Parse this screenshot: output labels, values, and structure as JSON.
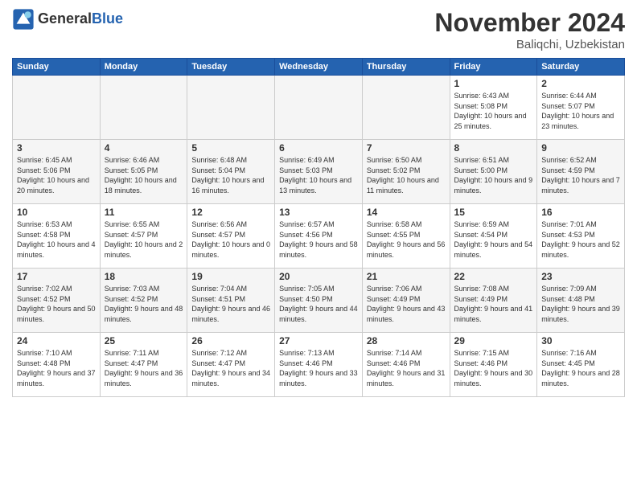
{
  "logo": {
    "line1": "General",
    "line2": "Blue"
  },
  "header": {
    "title": "November 2024",
    "location": "Baliqchi, Uzbekistan"
  },
  "days_header": [
    "Sunday",
    "Monday",
    "Tuesday",
    "Wednesday",
    "Thursday",
    "Friday",
    "Saturday"
  ],
  "weeks": [
    [
      {
        "day": "",
        "empty": true
      },
      {
        "day": "",
        "empty": true
      },
      {
        "day": "",
        "empty": true
      },
      {
        "day": "",
        "empty": true
      },
      {
        "day": "",
        "empty": true
      },
      {
        "day": "1",
        "sunrise": "6:43 AM",
        "sunset": "5:08 PM",
        "daylight": "10 hours and 25 minutes."
      },
      {
        "day": "2",
        "sunrise": "6:44 AM",
        "sunset": "5:07 PM",
        "daylight": "10 hours and 23 minutes."
      }
    ],
    [
      {
        "day": "3",
        "sunrise": "6:45 AM",
        "sunset": "5:06 PM",
        "daylight": "10 hours and 20 minutes."
      },
      {
        "day": "4",
        "sunrise": "6:46 AM",
        "sunset": "5:05 PM",
        "daylight": "10 hours and 18 minutes."
      },
      {
        "day": "5",
        "sunrise": "6:48 AM",
        "sunset": "5:04 PM",
        "daylight": "10 hours and 16 minutes."
      },
      {
        "day": "6",
        "sunrise": "6:49 AM",
        "sunset": "5:03 PM",
        "daylight": "10 hours and 13 minutes."
      },
      {
        "day": "7",
        "sunrise": "6:50 AM",
        "sunset": "5:02 PM",
        "daylight": "10 hours and 11 minutes."
      },
      {
        "day": "8",
        "sunrise": "6:51 AM",
        "sunset": "5:00 PM",
        "daylight": "10 hours and 9 minutes."
      },
      {
        "day": "9",
        "sunrise": "6:52 AM",
        "sunset": "4:59 PM",
        "daylight": "10 hours and 7 minutes."
      }
    ],
    [
      {
        "day": "10",
        "sunrise": "6:53 AM",
        "sunset": "4:58 PM",
        "daylight": "10 hours and 4 minutes."
      },
      {
        "day": "11",
        "sunrise": "6:55 AM",
        "sunset": "4:57 PM",
        "daylight": "10 hours and 2 minutes."
      },
      {
        "day": "12",
        "sunrise": "6:56 AM",
        "sunset": "4:57 PM",
        "daylight": "10 hours and 0 minutes."
      },
      {
        "day": "13",
        "sunrise": "6:57 AM",
        "sunset": "4:56 PM",
        "daylight": "9 hours and 58 minutes."
      },
      {
        "day": "14",
        "sunrise": "6:58 AM",
        "sunset": "4:55 PM",
        "daylight": "9 hours and 56 minutes."
      },
      {
        "day": "15",
        "sunrise": "6:59 AM",
        "sunset": "4:54 PM",
        "daylight": "9 hours and 54 minutes."
      },
      {
        "day": "16",
        "sunrise": "7:01 AM",
        "sunset": "4:53 PM",
        "daylight": "9 hours and 52 minutes."
      }
    ],
    [
      {
        "day": "17",
        "sunrise": "7:02 AM",
        "sunset": "4:52 PM",
        "daylight": "9 hours and 50 minutes."
      },
      {
        "day": "18",
        "sunrise": "7:03 AM",
        "sunset": "4:52 PM",
        "daylight": "9 hours and 48 minutes."
      },
      {
        "day": "19",
        "sunrise": "7:04 AM",
        "sunset": "4:51 PM",
        "daylight": "9 hours and 46 minutes."
      },
      {
        "day": "20",
        "sunrise": "7:05 AM",
        "sunset": "4:50 PM",
        "daylight": "9 hours and 44 minutes."
      },
      {
        "day": "21",
        "sunrise": "7:06 AM",
        "sunset": "4:49 PM",
        "daylight": "9 hours and 43 minutes."
      },
      {
        "day": "22",
        "sunrise": "7:08 AM",
        "sunset": "4:49 PM",
        "daylight": "9 hours and 41 minutes."
      },
      {
        "day": "23",
        "sunrise": "7:09 AM",
        "sunset": "4:48 PM",
        "daylight": "9 hours and 39 minutes."
      }
    ],
    [
      {
        "day": "24",
        "sunrise": "7:10 AM",
        "sunset": "4:48 PM",
        "daylight": "9 hours and 37 minutes."
      },
      {
        "day": "25",
        "sunrise": "7:11 AM",
        "sunset": "4:47 PM",
        "daylight": "9 hours and 36 minutes."
      },
      {
        "day": "26",
        "sunrise": "7:12 AM",
        "sunset": "4:47 PM",
        "daylight": "9 hours and 34 minutes."
      },
      {
        "day": "27",
        "sunrise": "7:13 AM",
        "sunset": "4:46 PM",
        "daylight": "9 hours and 33 minutes."
      },
      {
        "day": "28",
        "sunrise": "7:14 AM",
        "sunset": "4:46 PM",
        "daylight": "9 hours and 31 minutes."
      },
      {
        "day": "29",
        "sunrise": "7:15 AM",
        "sunset": "4:46 PM",
        "daylight": "9 hours and 30 minutes."
      },
      {
        "day": "30",
        "sunrise": "7:16 AM",
        "sunset": "4:45 PM",
        "daylight": "9 hours and 28 minutes."
      }
    ]
  ],
  "labels": {
    "sunrise": "Sunrise:",
    "sunset": "Sunset:",
    "daylight": "Daylight:"
  }
}
